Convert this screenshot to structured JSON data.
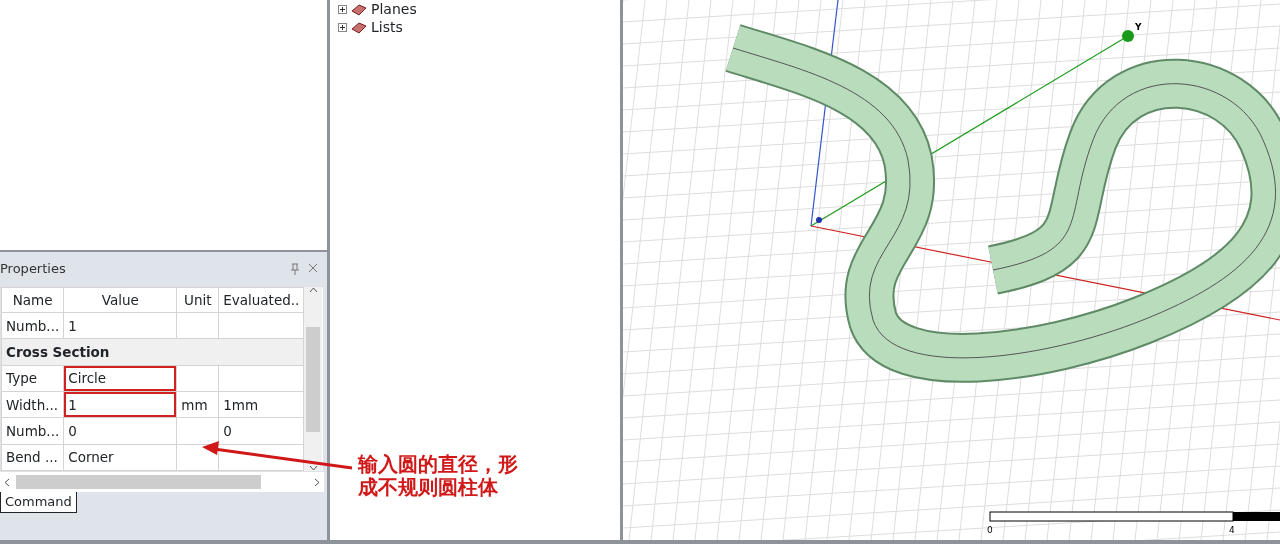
{
  "tree": {
    "items": [
      {
        "label": "Planes",
        "expanded": false
      },
      {
        "label": "Lists",
        "expanded": false
      }
    ]
  },
  "properties": {
    "title": "Properties",
    "columns": [
      "Name",
      "Value",
      "Unit",
      "Evaluated.."
    ],
    "rows": [
      {
        "kind": "row",
        "cells": [
          "Numb...",
          "1",
          "",
          ""
        ]
      },
      {
        "kind": "section",
        "title": "Cross Section"
      },
      {
        "kind": "row",
        "cells": [
          "Type",
          "Circle",
          "",
          ""
        ],
        "highlighted": true
      },
      {
        "kind": "row",
        "cells": [
          "Width...",
          "1",
          "mm",
          "1mm"
        ],
        "highlighted": true
      },
      {
        "kind": "row",
        "cells": [
          "Numb...",
          "0",
          "",
          "0"
        ]
      },
      {
        "kind": "row",
        "cells": [
          "Bend ...",
          "Corner",
          "",
          ""
        ]
      }
    ],
    "tab": "Command"
  },
  "annotation": {
    "text": "输入圆的直径，形成不规则圆柱体"
  },
  "viewport": {
    "axis_label": "Y",
    "scale_labels": [
      "0",
      "4"
    ]
  }
}
